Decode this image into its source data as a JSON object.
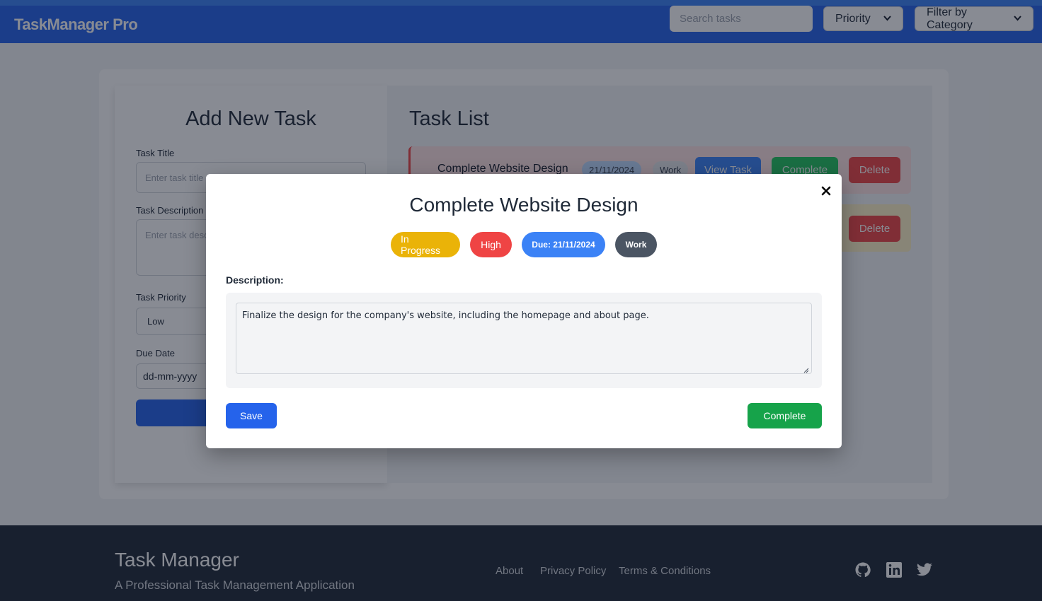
{
  "header": {
    "brand": "TaskManager Pro",
    "search_placeholder": "Search tasks",
    "priority_select": "Priority",
    "category_select": "Filter by Category"
  },
  "form": {
    "title": "Add New Task",
    "task_title_label": "Task Title",
    "task_title_placeholder": "Enter task title",
    "task_description_label": "Task Description",
    "task_description_placeholder": "Enter task desc",
    "task_priority_label": "Task Priority",
    "task_priority_value": "Low",
    "due_date_label": "Due Date",
    "due_date_placeholder": "dd-mm-yyyy"
  },
  "task_list": {
    "title": "Task List",
    "tasks": [
      {
        "name": "Complete Website Design",
        "date": "21/11/2024",
        "category": "Work",
        "view_label": "View Task",
        "complete_label": "Complete",
        "delete_label": "Delete"
      },
      {
        "delete_label": "Delete"
      }
    ]
  },
  "modal": {
    "title": "Complete Website Design",
    "status": "In Progress",
    "priority": "High",
    "due": "Due: 21/11/2024",
    "category": "Work",
    "description_label": "Description:",
    "description": "Finalize the design for the company's website, including the homepage and about page.",
    "save_label": "Save",
    "complete_label": "Complete"
  },
  "footer": {
    "title": "Task Manager",
    "subtitle": "A Professional Task Management Application",
    "links": [
      "About",
      "Privacy Policy",
      "Terms & Conditions"
    ],
    "social_icons": [
      "github-icon",
      "linkedin-icon",
      "twitter-icon"
    ]
  },
  "colors": {
    "primary": "#2563eb",
    "success": "#16a34a",
    "danger": "#ef4444",
    "warning": "#eab308",
    "footer": "#1f2937"
  }
}
